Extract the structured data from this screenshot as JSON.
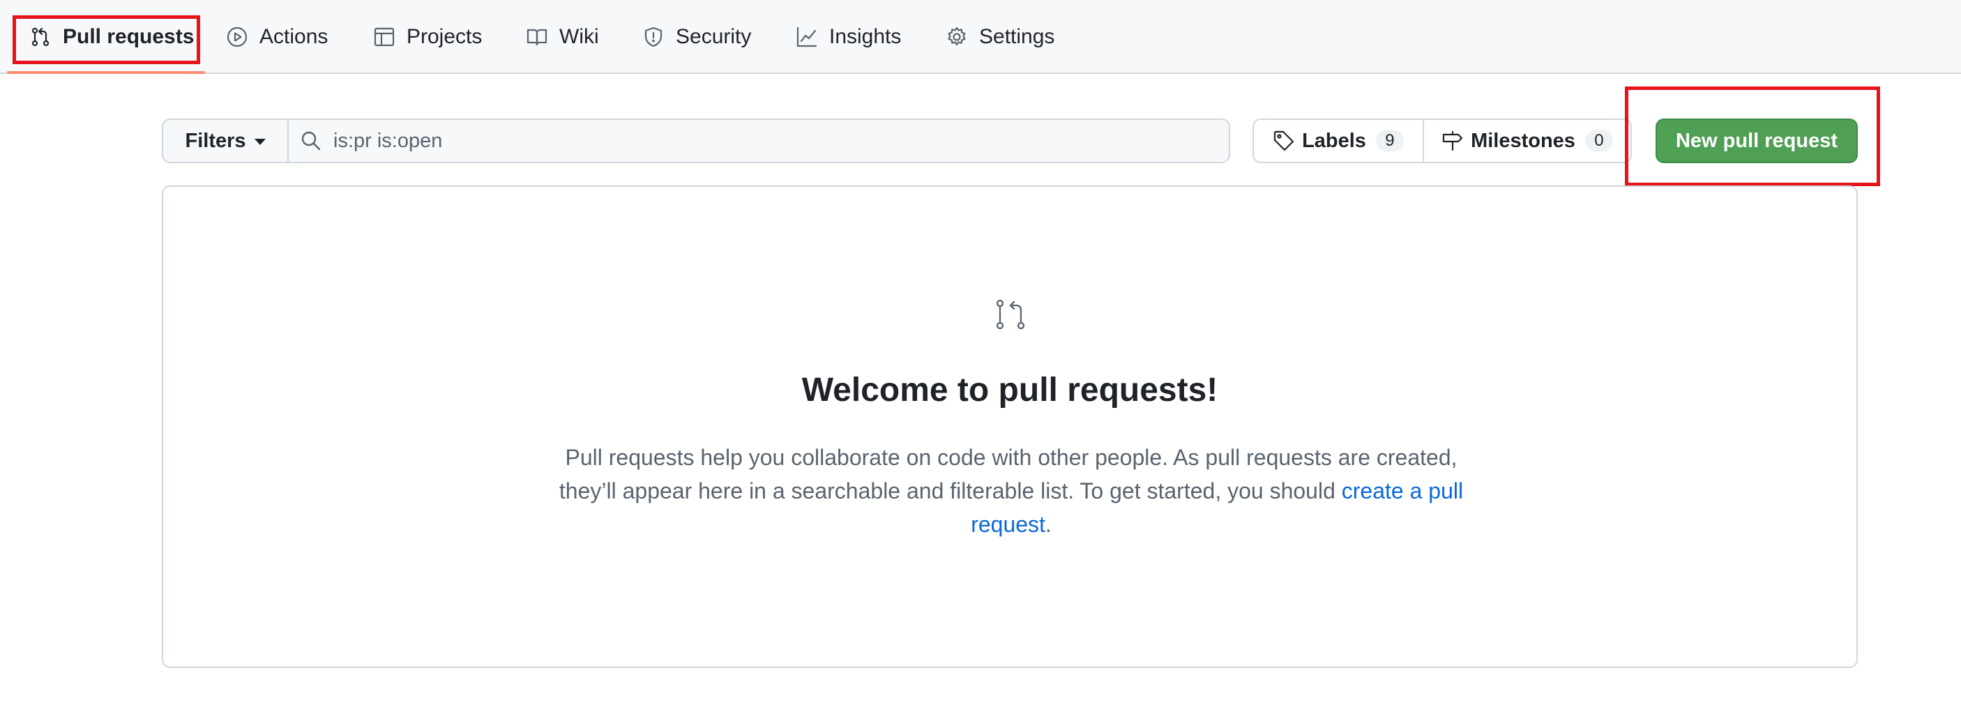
{
  "repo_nav": {
    "items": [
      {
        "label": "Pull requests",
        "icon": "git-pull-request-icon",
        "selected": true
      },
      {
        "label": "Actions",
        "icon": "play-circle-icon"
      },
      {
        "label": "Projects",
        "icon": "table-icon"
      },
      {
        "label": "Wiki",
        "icon": "book-icon"
      },
      {
        "label": "Security",
        "icon": "shield-icon"
      },
      {
        "label": "Insights",
        "icon": "graph-icon"
      },
      {
        "label": "Settings",
        "icon": "gear-icon"
      }
    ]
  },
  "toolbar": {
    "filters_label": "Filters",
    "search_value": "is:pr is:open",
    "labels_label": "Labels",
    "labels_count": "9",
    "milestones_label": "Milestones",
    "milestones_count": "0",
    "new_pr_label": "New pull request"
  },
  "blankslate": {
    "icon": "git-pull-request-icon",
    "title": "Welcome to pull requests!",
    "description_before": "Pull requests help you collaborate on code with other people. As pull requests are created, they’ll appear here in a searchable and filterable list. To get started, you should ",
    "link_text": "create a pull request",
    "description_after": "."
  },
  "colors": {
    "primary_button": "#4f9f55",
    "link": "#0969da",
    "selected_tab_underline": "#fd8c73",
    "highlight": "#e5141c"
  }
}
